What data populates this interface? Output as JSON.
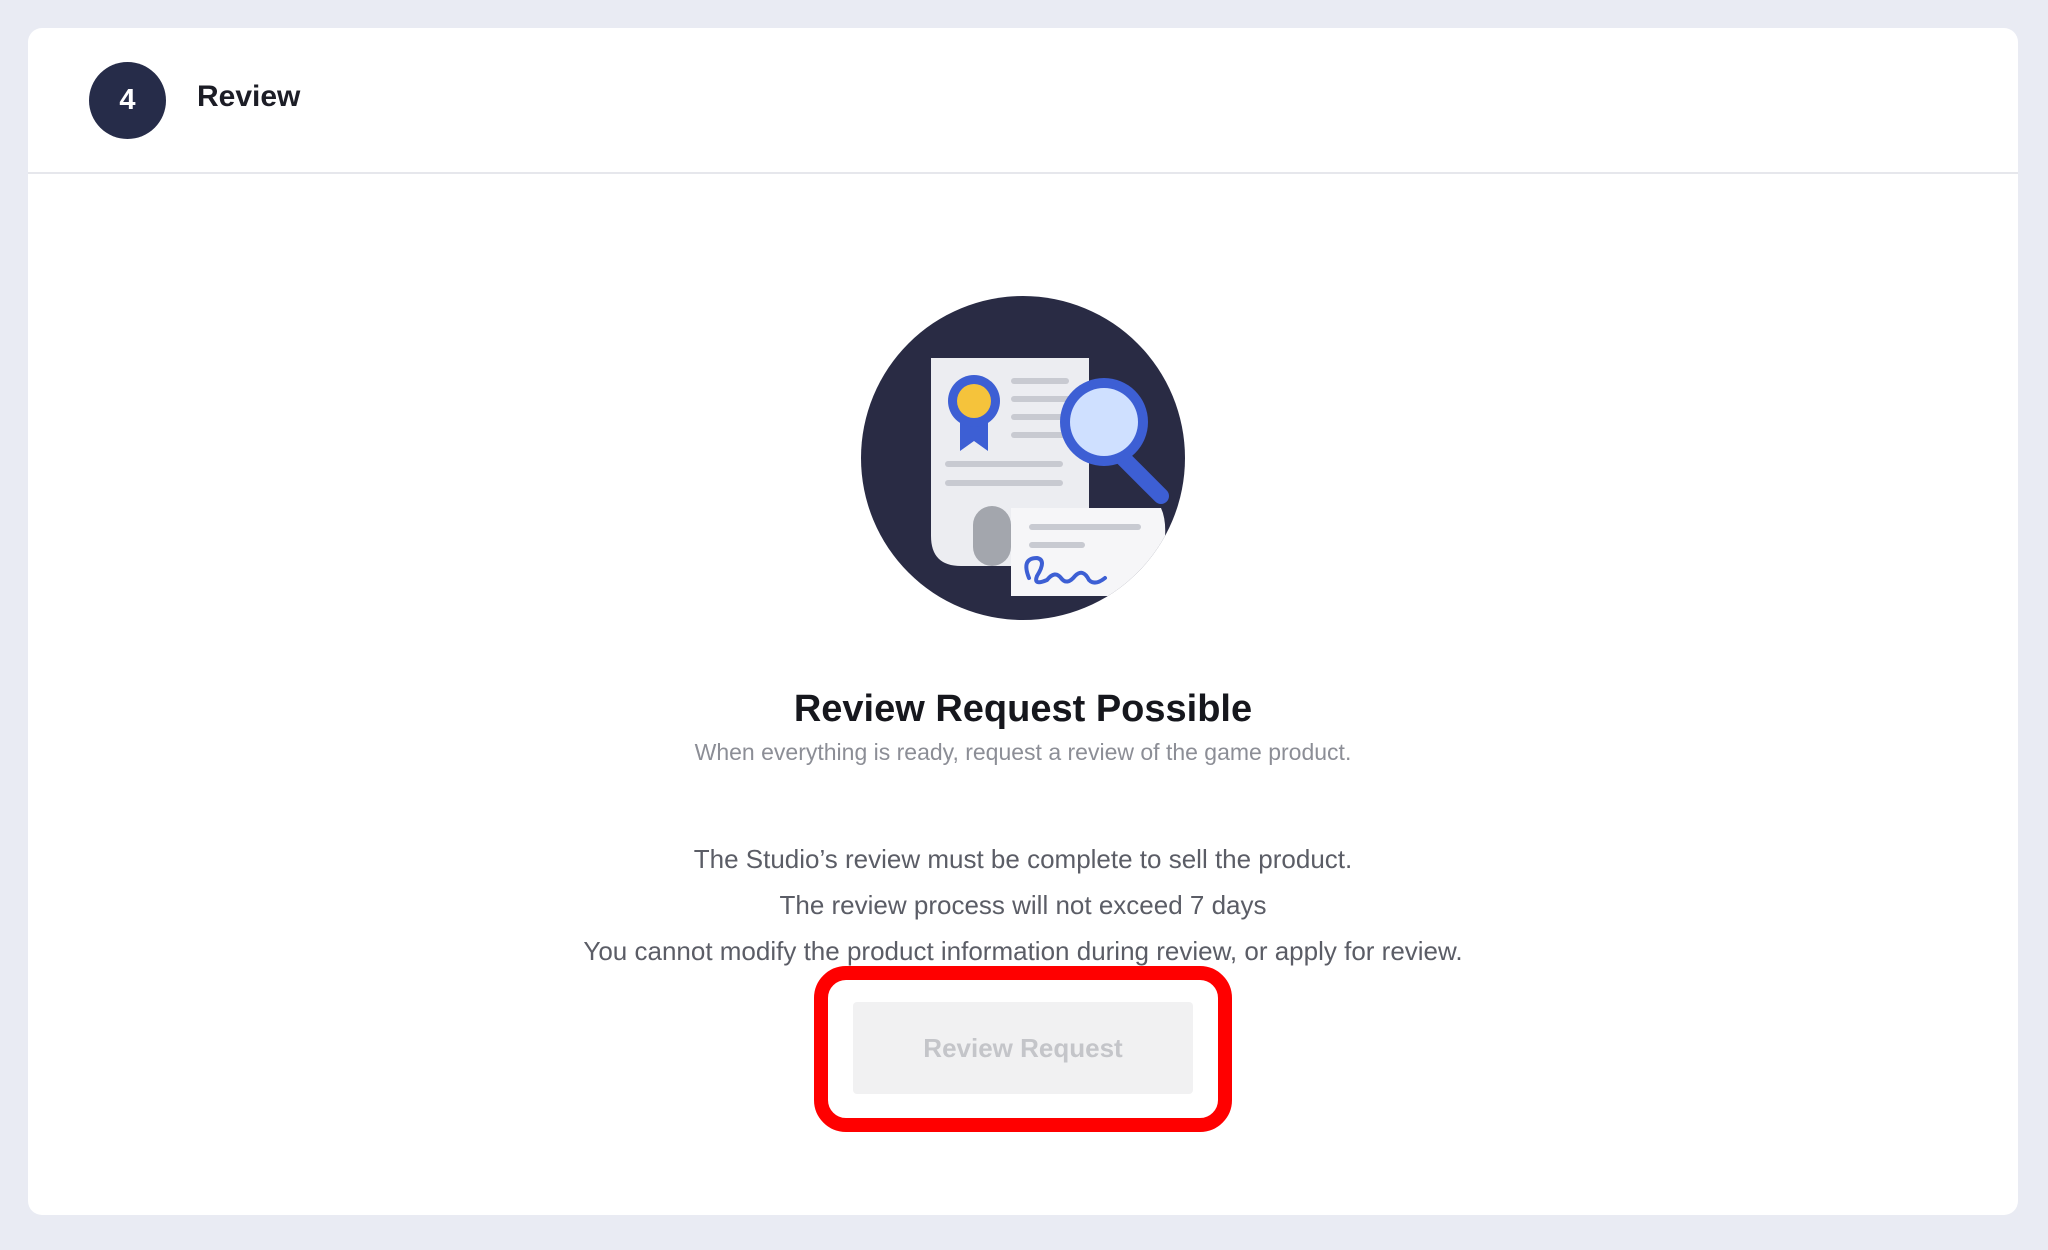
{
  "step": {
    "number": "4",
    "title": "Review"
  },
  "status": {
    "title": "Review Request Possible",
    "subtitle": "When everything is ready, request a review of the game product."
  },
  "info_lines": [
    "The Studio’s review must be complete to sell the product.",
    "The review process will not exceed 7 days",
    "You cannot modify the product information during review, or apply for review."
  ],
  "review_button": {
    "label": "Review Request",
    "state": "disabled"
  },
  "colors": {
    "background": "#e9ebf3",
    "badge": "#262c49",
    "highlight": "#ff0000",
    "button_bg": "#f1f1f2",
    "button_text": "#c4c5c9"
  },
  "illustration": {
    "icon": "certificate-review-icon"
  }
}
